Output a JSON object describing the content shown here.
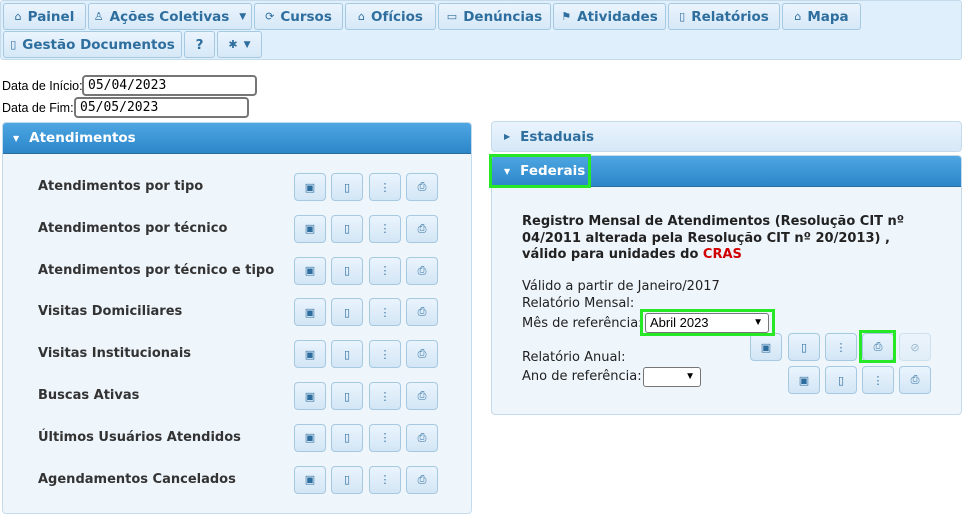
{
  "nav": {
    "items": [
      {
        "label": "Painel",
        "icon": "home-icon"
      },
      {
        "label": "Ações Coletivas",
        "icon": "users-icon"
      },
      {
        "label": "Cursos",
        "icon": "courses-icon"
      },
      {
        "label": "Ofícios",
        "icon": "building-icon"
      },
      {
        "label": "Denúncias",
        "icon": "comment-icon"
      },
      {
        "label": "Atividades",
        "icon": "flag-icon"
      },
      {
        "label": "Relatórios",
        "icon": "document-icon"
      },
      {
        "label": "Mapa",
        "icon": "home-icon"
      },
      {
        "label": "Gestão Documentos",
        "icon": "document-icon"
      },
      {
        "label": "?",
        "icon": ""
      },
      {
        "label": "",
        "icon": "gear-icon"
      }
    ]
  },
  "dates": {
    "start_label": "Data de Início:",
    "start_value": "05/04/2023",
    "end_label": "Data de Fim:",
    "end_value": "05/05/2023"
  },
  "atendimentos": {
    "title": "Atendimentos",
    "reports": [
      "Atendimentos por tipo",
      "Atendimentos por técnico",
      "Atendimentos por técnico e tipo",
      "Visitas Domiciliares",
      "Visitas Institucionais",
      "Buscas Ativas",
      "Últimos Usuários Atendidos",
      "Agendamentos Cancelados"
    ]
  },
  "estaduais": {
    "title": "Estaduais"
  },
  "federais": {
    "title": "Federais",
    "desc_line1": "Registro Mensal de Atendimentos (Resolução CIT nº",
    "desc_line2": "04/2011 alterada pela Resolução CIT nº 20/2013) ,",
    "desc_line3": "válido para unidades do ",
    "desc_cras": "CRAS",
    "valid_from": "Válido a partir de Janeiro/2017",
    "monthly_label": "Relatório Mensal:",
    "month_ref_label": "Mês de referência:",
    "month_ref_value": "Abril 2023",
    "annual_label": "Relatório Anual:",
    "year_ref_label": "Ano de referência:",
    "year_ref_value": ""
  },
  "colors": {
    "header_blue": "#2c86c9",
    "highlight_green": "#27e827",
    "cras_red": "#d00000"
  }
}
